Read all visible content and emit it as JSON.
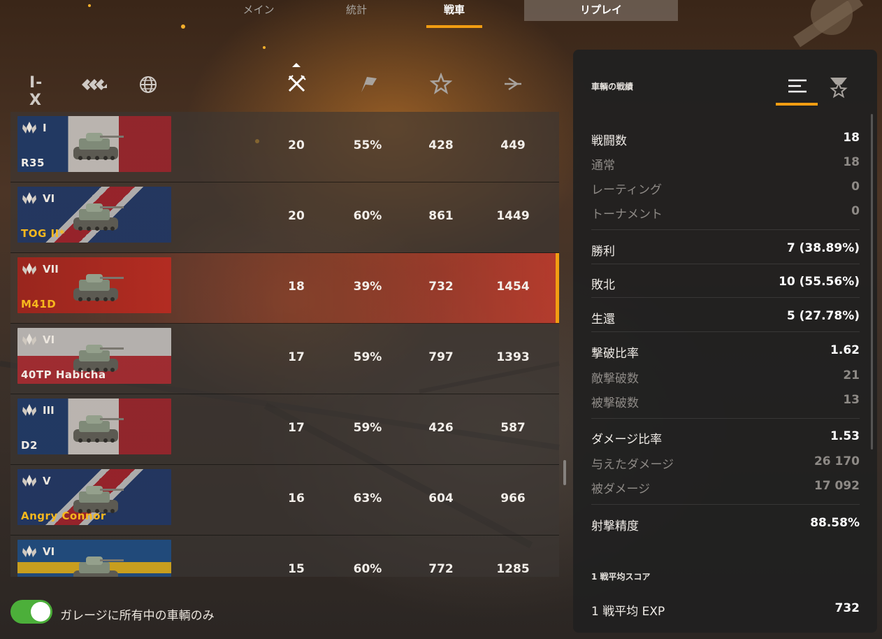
{
  "top_tabs": {
    "main": "メイン",
    "stats": "統計",
    "vehicles": "戦車",
    "replay": "リプレイ"
  },
  "filters": {
    "tier": "I-X"
  },
  "rows": [
    {
      "tier": "I",
      "name": "R35",
      "battles": "20",
      "winrate": "55%",
      "avg_dmg": "428",
      "avg_exp": "449",
      "premium": false,
      "flag": "france",
      "selected": false
    },
    {
      "tier": "VI",
      "name": "TOG II*",
      "battles": "20",
      "winrate": "60%",
      "avg_dmg": "861",
      "avg_exp": "1449",
      "premium": true,
      "flag": "uk",
      "selected": false
    },
    {
      "tier": "VII",
      "name": "M41D",
      "battles": "18",
      "winrate": "39%",
      "avg_dmg": "732",
      "avg_exp": "1454",
      "premium": true,
      "flag": "china",
      "selected": true
    },
    {
      "tier": "VI",
      "name": "40TP Habicha",
      "battles": "17",
      "winrate": "59%",
      "avg_dmg": "797",
      "avg_exp": "1393",
      "premium": false,
      "flag": "poland",
      "selected": false
    },
    {
      "tier": "III",
      "name": "D2",
      "battles": "17",
      "winrate": "59%",
      "avg_dmg": "426",
      "avg_exp": "587",
      "premium": false,
      "flag": "france",
      "selected": false
    },
    {
      "tier": "V",
      "name": "Angry Connor",
      "battles": "16",
      "winrate": "63%",
      "avg_dmg": "604",
      "avg_exp": "966",
      "premium": true,
      "flag": "uk",
      "selected": false
    },
    {
      "tier": "VI",
      "name": "",
      "battles": "15",
      "winrate": "60%",
      "avg_dmg": "772",
      "avg_exp": "1285",
      "premium": false,
      "flag": "sweden",
      "selected": false
    }
  ],
  "toggle": {
    "label": "ガレージに所有中の車輌のみ",
    "on": true
  },
  "panel": {
    "title": "車輌の戦績",
    "battles": {
      "label": "戦闘数",
      "value": "18"
    },
    "regular": {
      "label": "通常",
      "value": "18"
    },
    "rating": {
      "label": "レーティング",
      "value": "0"
    },
    "tournament": {
      "label": "トーナメント",
      "value": "0"
    },
    "wins": {
      "label": "勝利",
      "value": "7 (38.89%)"
    },
    "losses": {
      "label": "敗北",
      "value": "10 (55.56%)"
    },
    "survived": {
      "label": "生還",
      "value": "5 (27.78%)"
    },
    "kd_ratio": {
      "label": "撃破比率",
      "value": "1.62"
    },
    "kills": {
      "label": "敵撃破数",
      "value": "21"
    },
    "deaths": {
      "label": "被撃破数",
      "value": "13"
    },
    "dmg_ratio": {
      "label": "ダメージ比率",
      "value": "1.53"
    },
    "dmg_dealt": {
      "label": "与えたダメージ",
      "value": "26 170"
    },
    "dmg_received": {
      "label": "被ダメージ",
      "value": "17 092"
    },
    "accuracy": {
      "label": "射撃精度",
      "value": "88.58%"
    },
    "avg_section": "1 戦平均スコア",
    "avg_exp": {
      "label": "1 戦平均 EXP",
      "value": "732"
    }
  },
  "colors": {
    "accent": "#f29d12",
    "toggle_on": "#4caf3a",
    "premium_name": "#f7b81d"
  },
  "icons": {
    "nation_filter": "nation-icon",
    "type_filter": "vehicle-type-icon",
    "col_battles": "crossed-swords-icon",
    "col_winrate": "victory-flag-icon",
    "col_avg_exp": "star-icon",
    "col_avg_dmg": "damage-icon"
  }
}
